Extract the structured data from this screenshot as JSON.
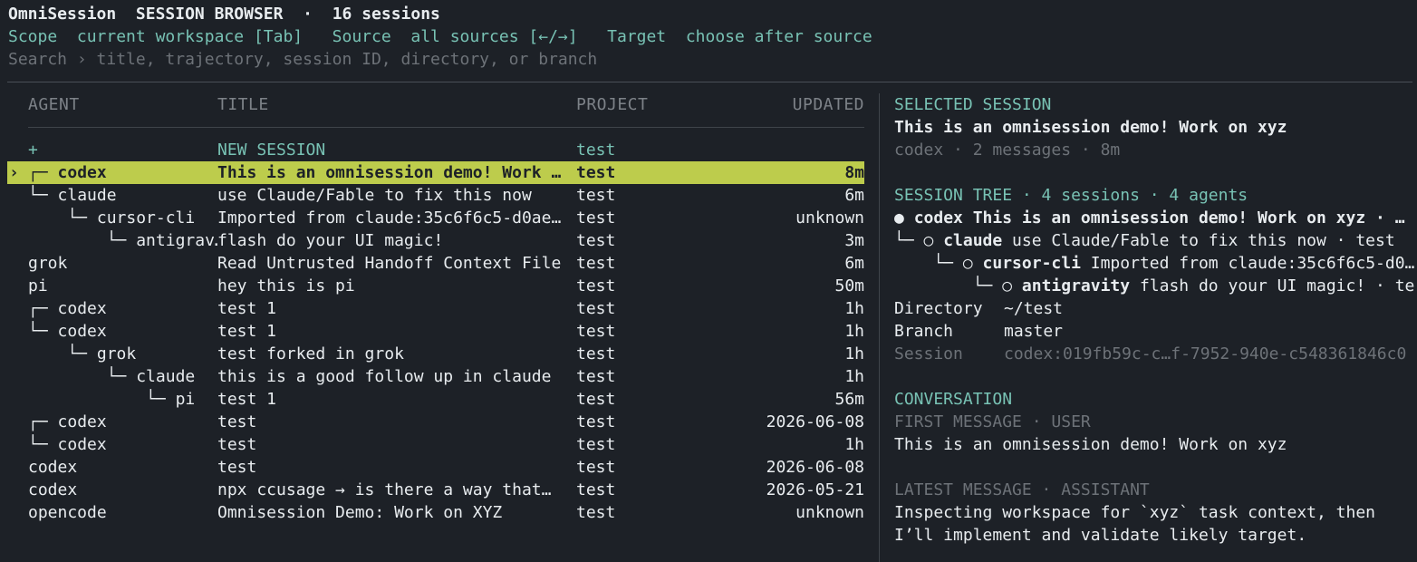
{
  "header": {
    "app_name": "OmniSession",
    "mode": "SESSION BROWSER",
    "separator": "·",
    "count": "16 sessions"
  },
  "filters": {
    "scope_label": "Scope",
    "scope_value": "current workspace [Tab]",
    "source_label": "Source",
    "source_value": "all sources [←/→]",
    "target_label": "Target",
    "target_value": "choose after source"
  },
  "search": {
    "placeholder": "Search › title, trajectory, session ID, directory, or branch"
  },
  "table": {
    "headers": {
      "agent": "AGENT",
      "title": "TITLE",
      "project": "PROJECT",
      "updated": "UPDATED"
    },
    "new_session": {
      "marker": "+",
      "title": "NEW SESSION",
      "project": "test"
    },
    "rows": [
      {
        "marker": "›",
        "tree": "┌─ ",
        "agent": "codex",
        "title": "This is an omnisession demo! Work …",
        "project": "test",
        "updated": "8m",
        "selected": true
      },
      {
        "marker": "",
        "tree": "└─ ",
        "agent": "claude",
        "title": "use Claude/Fable to fix this now",
        "project": "test",
        "updated": "6m"
      },
      {
        "marker": "",
        "tree": "    └─ ",
        "agent": "cursor-cli",
        "title": "Imported from claude:35c6f6c5-d0ae…",
        "project": "test",
        "updated": "unknown"
      },
      {
        "marker": "",
        "tree": "        └─ ",
        "agent": "antigrav…",
        "title": "flash do your UI magic!",
        "project": "test",
        "updated": "3m"
      },
      {
        "marker": "",
        "tree": "",
        "agent": "grok",
        "title": "Read Untrusted Handoff Context File",
        "project": "test",
        "updated": "6m"
      },
      {
        "marker": "",
        "tree": "",
        "agent": "pi",
        "title": "hey this is pi",
        "project": "test",
        "updated": "50m"
      },
      {
        "marker": "",
        "tree": "┌─ ",
        "agent": "codex",
        "title": "test 1",
        "project": "test",
        "updated": "1h"
      },
      {
        "marker": "",
        "tree": "└─ ",
        "agent": "codex",
        "title": "test 1",
        "project": "test",
        "updated": "1h"
      },
      {
        "marker": "",
        "tree": "    └─ ",
        "agent": "grok",
        "title": "test forked in grok",
        "project": "test",
        "updated": "1h"
      },
      {
        "marker": "",
        "tree": "        └─ ",
        "agent": "claude",
        "title": "this is a good follow up in claude",
        "project": "test",
        "updated": "1h"
      },
      {
        "marker": "",
        "tree": "            └─ ",
        "agent": "pi",
        "title": "test 1",
        "project": "test",
        "updated": "56m"
      },
      {
        "marker": "",
        "tree": "┌─ ",
        "agent": "codex",
        "title": "test",
        "project": "test",
        "updated": "2026-06-08"
      },
      {
        "marker": "",
        "tree": "└─ ",
        "agent": "codex",
        "title": "test",
        "project": "test",
        "updated": "1h"
      },
      {
        "marker": "",
        "tree": "",
        "agent": "codex",
        "title": "test",
        "project": "test",
        "updated": "2026-06-08"
      },
      {
        "marker": "",
        "tree": "",
        "agent": "codex",
        "title": "npx ccusage → is there a way that…",
        "project": "test",
        "updated": "2026-05-21"
      },
      {
        "marker": "",
        "tree": "",
        "agent": "opencode",
        "title": "Omnisession Demo: Work on XYZ",
        "project": "test",
        "updated": "unknown"
      }
    ]
  },
  "selected": {
    "section_label": "SELECTED SESSION",
    "title": "This is an omnisession demo! Work on xyz",
    "meta": "codex · 2 messages · 8m",
    "tree_label": "SESSION TREE · 4 sessions · 4 agents",
    "tree": [
      {
        "prefix": "● ",
        "agent": "codex",
        "text": " This is an omnisession demo! Work on xyz · …",
        "bold": true
      },
      {
        "prefix": "└─ ○ ",
        "agent": "claude",
        "text": " use Claude/Fable to fix this now · test",
        "bold": false
      },
      {
        "prefix": "    └─ ○ ",
        "agent": "cursor-cli",
        "text": " Imported from claude:35c6f6c5-d0…",
        "bold": false
      },
      {
        "prefix": "        └─ ○ ",
        "agent": "antigravity",
        "text": " flash do your UI magic! · te…",
        "bold": false
      }
    ],
    "directory_label": "Directory",
    "directory_value": "~/test",
    "branch_label": "Branch",
    "branch_value": "master",
    "session_label": "Session",
    "session_value": "codex:019fb59c-c…f-7952-940e-c548361846c0",
    "conversation_label": "CONVERSATION",
    "first_label": "FIRST MESSAGE · USER",
    "first_text": "This is an omnisession demo! Work on xyz",
    "latest_label": "LATEST MESSAGE · ASSISTANT",
    "latest_line1": "Inspecting workspace for `xyz` task context, then",
    "latest_line2": "I’ll implement and validate likely target."
  }
}
